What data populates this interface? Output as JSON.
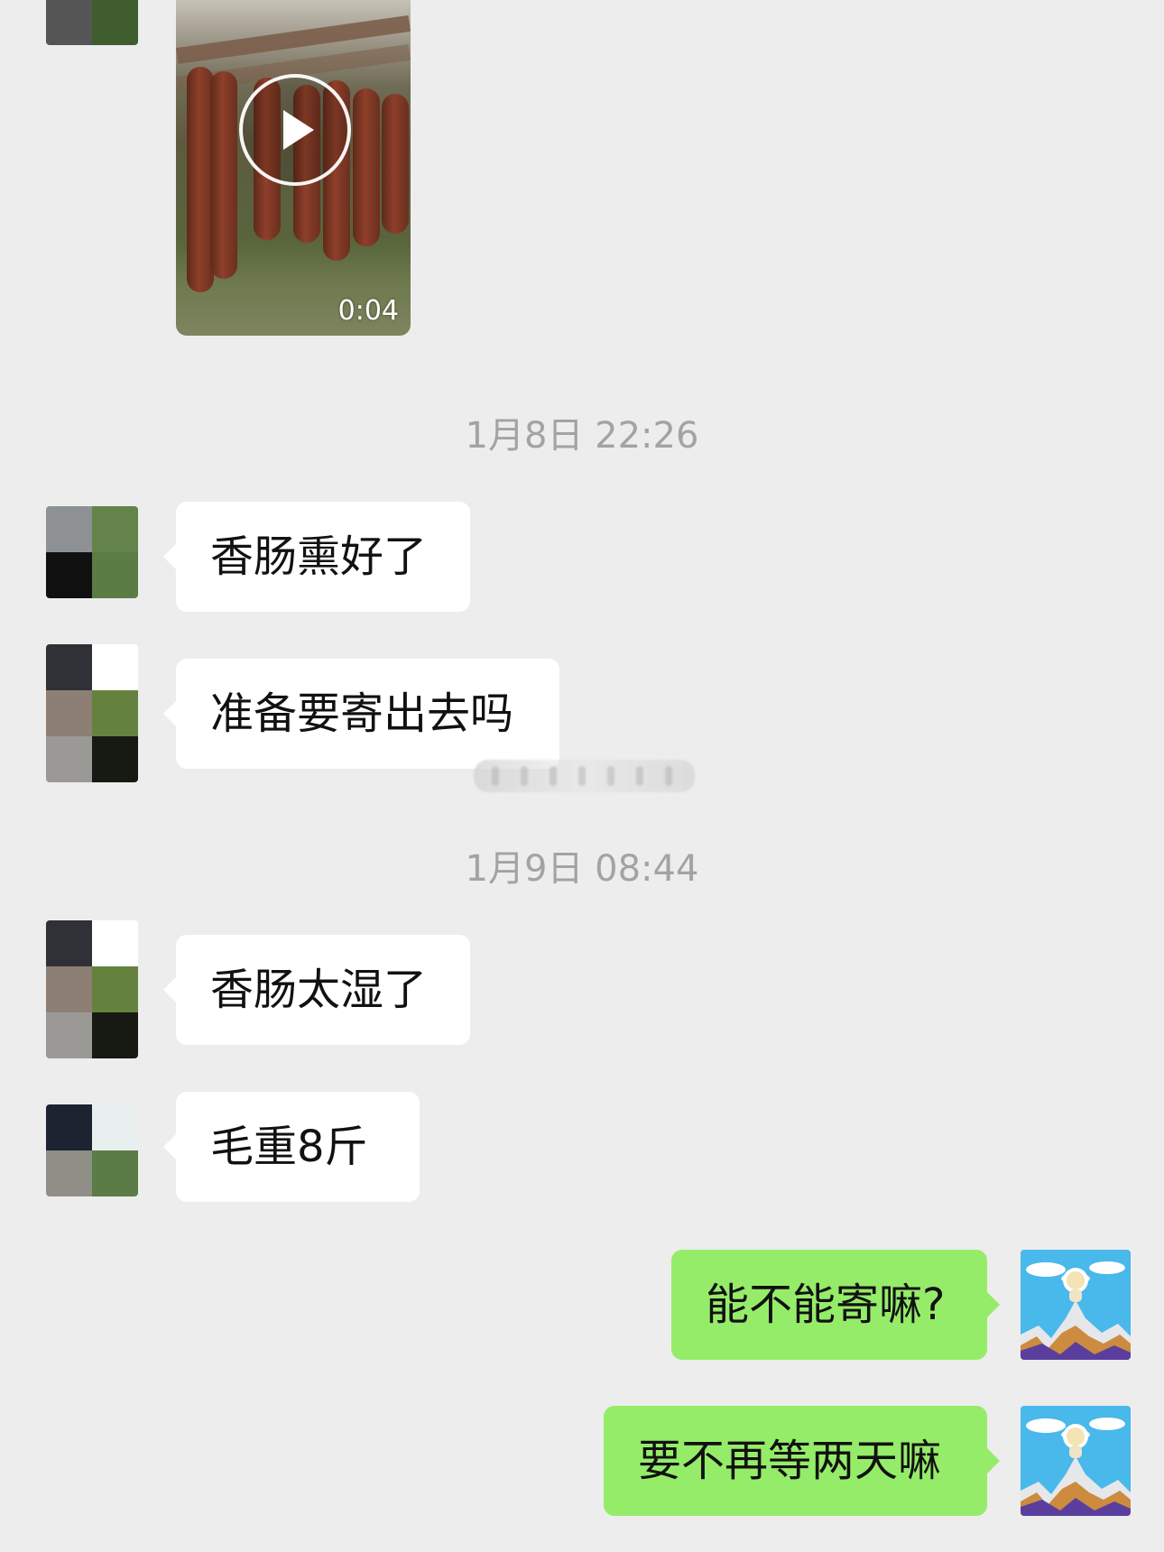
{
  "video_message": {
    "duration": "0:04",
    "play_icon": "play-icon",
    "sender_avatar_colors": [
      "#555555",
      "#3f5d2f"
    ]
  },
  "timestamps": [
    "1月8日 22:26",
    "1月9日 08:44"
  ],
  "messages": [
    {
      "text": "香肠熏好了",
      "direction": "incoming",
      "avatar_colors": [
        "#8e9194",
        "#63834a",
        "#101010",
        "#5c7c45"
      ]
    },
    {
      "text": "准备要寄出去吗",
      "direction": "incoming",
      "avatar_colors": [
        "#2f3136",
        "#ffffff",
        "#8d7f73",
        "#64823d",
        "#9a9996",
        "#161a12"
      ]
    },
    {
      "text": "香肠太湿了",
      "direction": "incoming",
      "avatar_colors": [
        "#2f3136",
        "#ffffff",
        "#8d7f73",
        "#64823d",
        "#9a9996",
        "#161a12"
      ]
    },
    {
      "text": "毛重8斤",
      "direction": "incoming",
      "avatar_colors": [
        "#1c2331",
        "#e9eeee",
        "#8f8f88",
        "#5c7c47"
      ]
    },
    {
      "text": "能不能寄嘛?",
      "direction": "outgoing"
    },
    {
      "text": "要不再等两天嘛",
      "direction": "outgoing"
    }
  ],
  "colors": {
    "background": "#ededed",
    "incoming_bubble": "#ffffff",
    "outgoing_bubble": "#95ec69",
    "timestamp": "#a3a3a3",
    "text": "#111111"
  }
}
